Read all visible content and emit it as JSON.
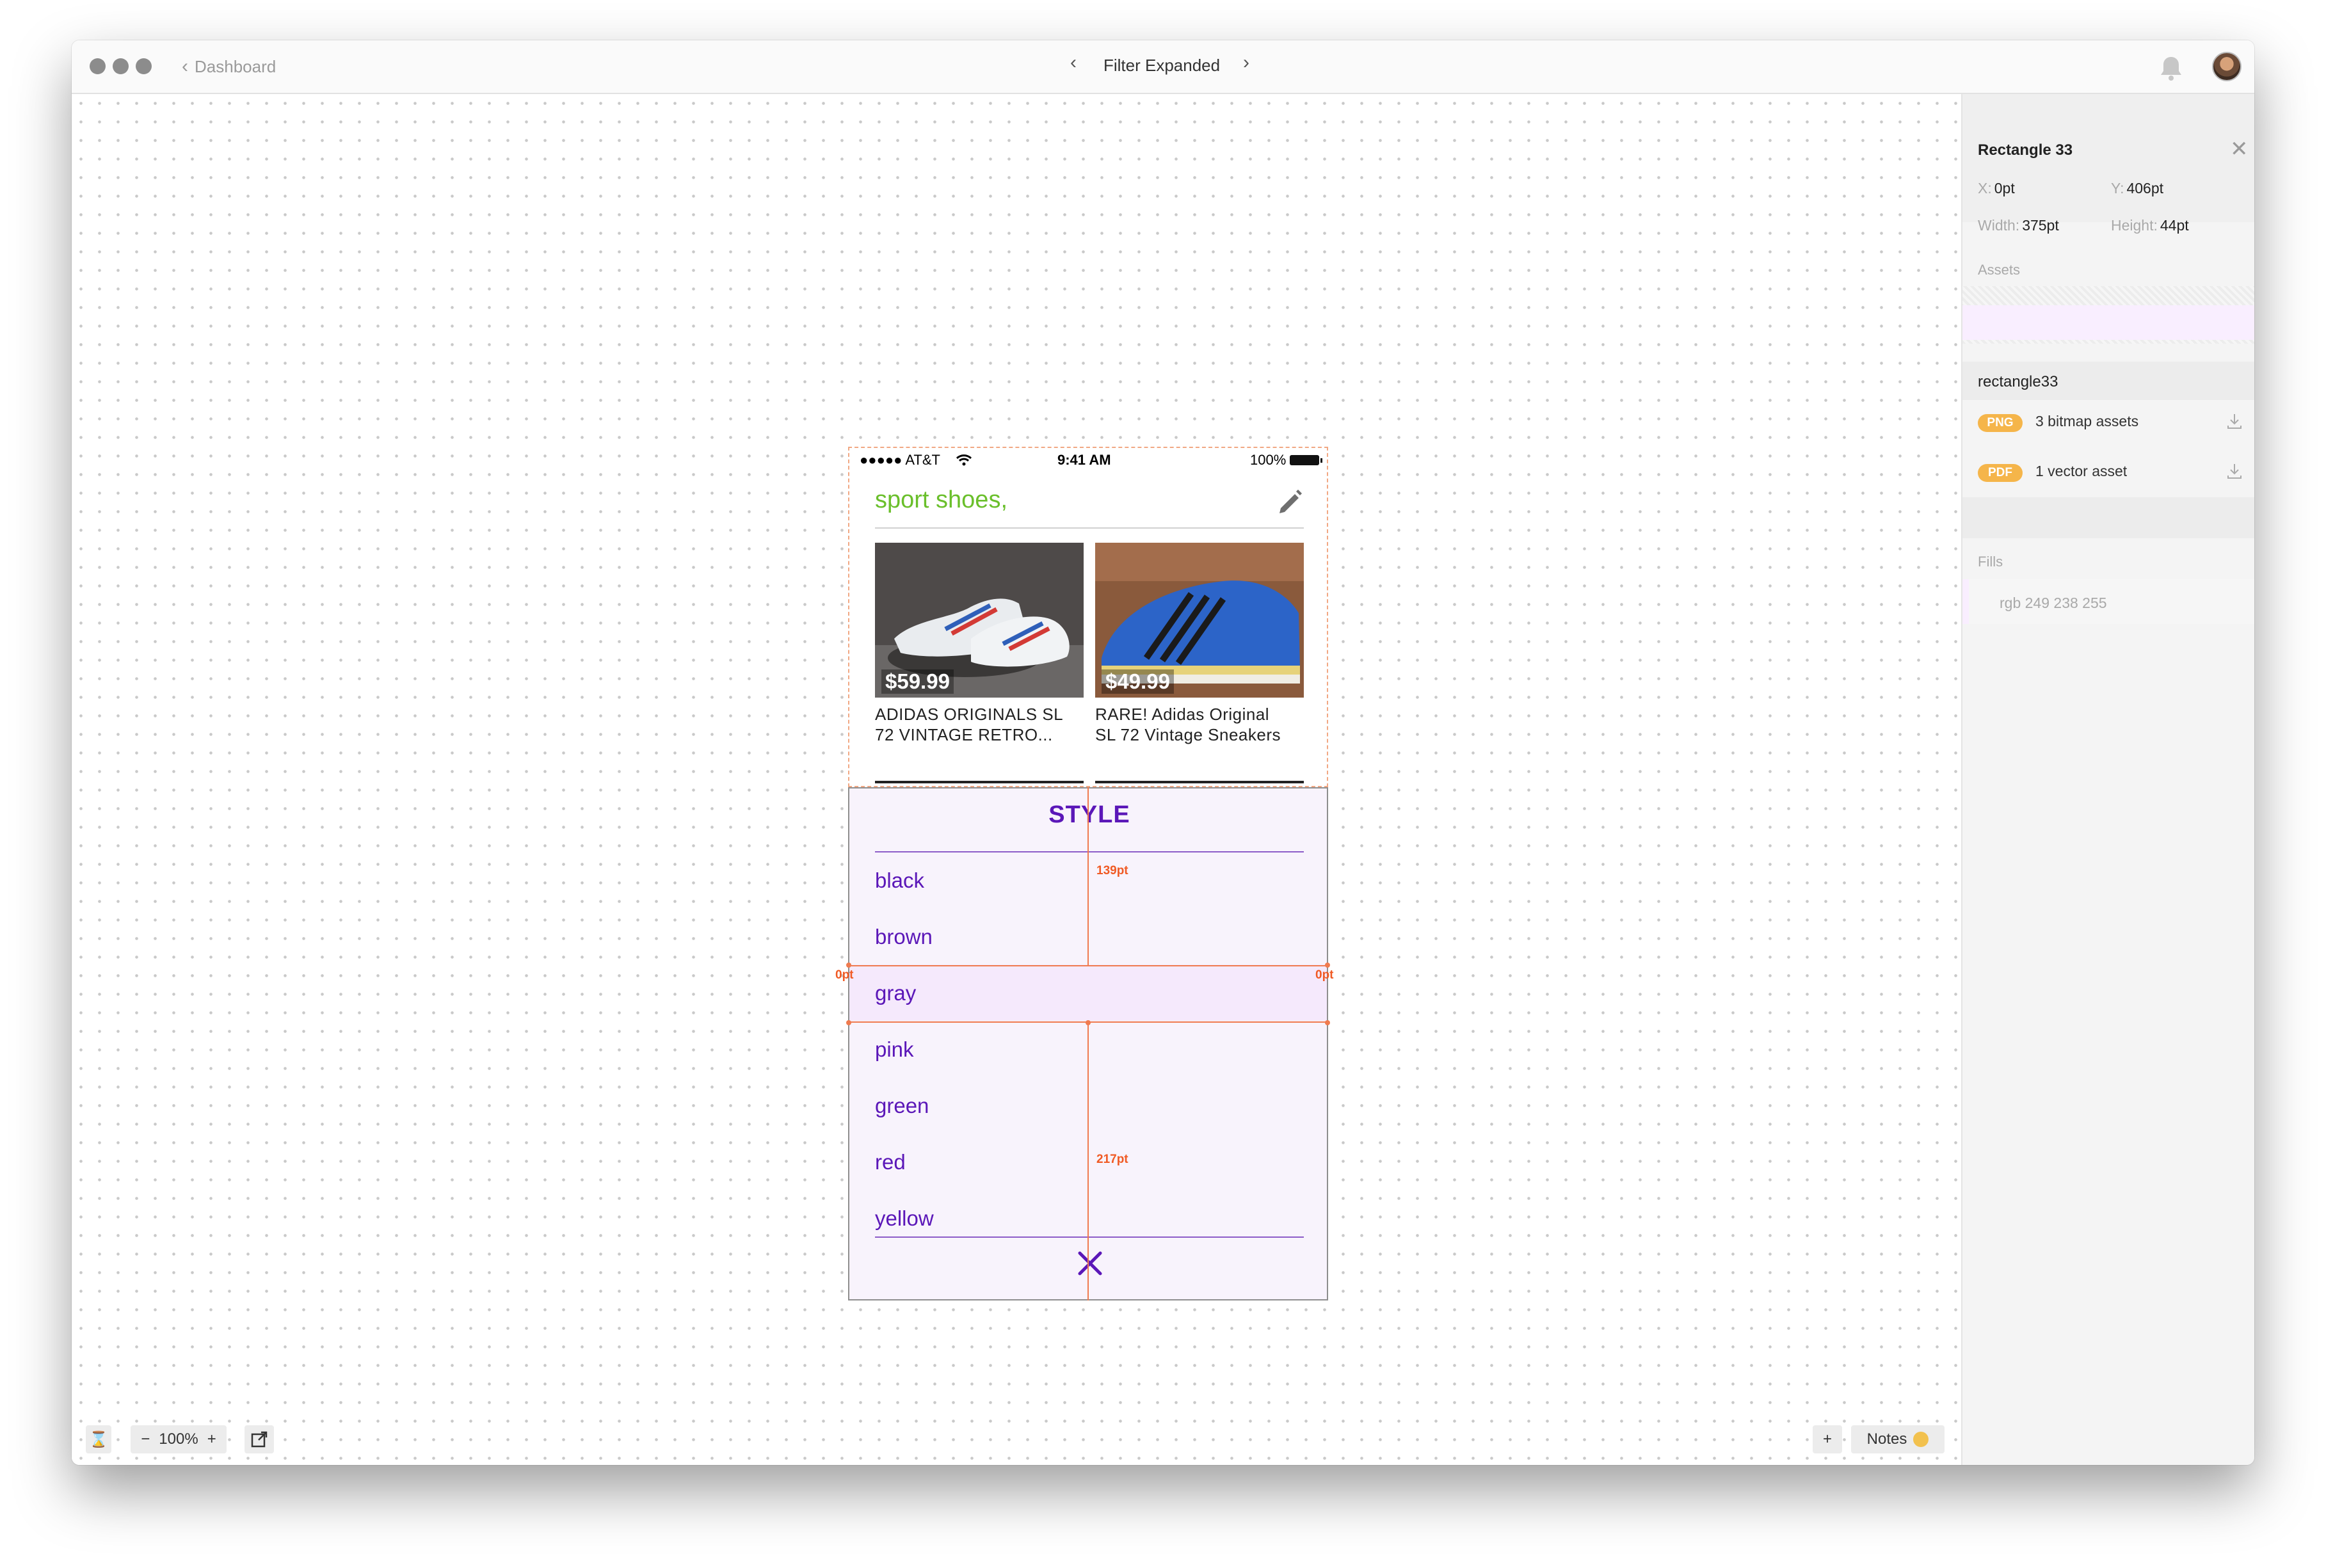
{
  "window": {
    "back_label": "Dashboard",
    "title": "Filter Expanded"
  },
  "toolbar": {
    "zoom": "100%",
    "minus": "−",
    "plus": "+",
    "add": "+",
    "notes_label": "Notes"
  },
  "inspector": {
    "layer_name": "Rectangle 33",
    "x_key": "X:",
    "x_val": "0pt",
    "y_key": "Y:",
    "y_val": "406pt",
    "width_key": "Width:",
    "width_val": "375pt",
    "height_key": "Height:",
    "height_val": "44pt",
    "assets_label": "Assets",
    "asset_name": "rectangle33",
    "assets": [
      {
        "badge": "PNG",
        "text": "3 bitmap assets"
      },
      {
        "badge": "PDF",
        "text": "1 vector asset"
      }
    ],
    "fills_label": "Fills",
    "fill_value": "rgb 249 238 255",
    "swatch_color": "#f9eeff"
  },
  "phone": {
    "carrier": "●●●●● AT&T",
    "time": "9:41 AM",
    "battery": "100%",
    "search_text": "sport shoes,",
    "products": [
      {
        "price": "$59.99",
        "title_line1": "ADIDAS ORIGINALS SL",
        "title_line2": "72 VINTAGE RETRO..."
      },
      {
        "price": "$49.99",
        "title_line1": "RARE! Adidas Original",
        "title_line2": "SL 72 Vintage Sneakers"
      }
    ],
    "filter": {
      "title": "STYLE",
      "options": [
        "black",
        "brown",
        "gray",
        "pink",
        "green",
        "red",
        "yellow"
      ],
      "selected": "gray"
    }
  },
  "measurements": {
    "top": "139pt",
    "left": "0pt",
    "right": "0pt",
    "bottom": "217pt"
  },
  "colors": {
    "accent_purple": "#5b17b8",
    "search_green": "#6abf2b",
    "measure_orange": "#f07b4f",
    "badge_orange": "#f5b54a"
  }
}
